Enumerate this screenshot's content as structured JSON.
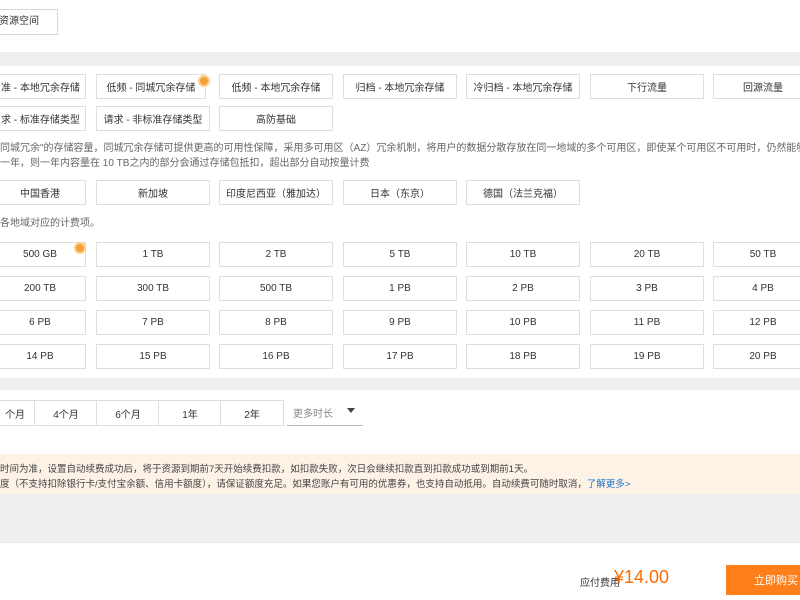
{
  "top": {
    "tag_label": "资源空间"
  },
  "storage_types": [
    {
      "label": "准 - 本地冗余存储"
    },
    {
      "label": "低频 - 同城冗余存储"
    },
    {
      "label": "低频 - 本地冗余存储"
    },
    {
      "label": "归档 - 本地冗余存储"
    },
    {
      "label": "冷归档 - 本地冗余存储"
    },
    {
      "label": "下行流量"
    },
    {
      "label": "回源流量"
    },
    {
      "label": "求 - 标准存储类型"
    },
    {
      "label": "请求 - 非标准存储类型"
    },
    {
      "label": "高防基础"
    }
  ],
  "storage_desc": {
    "line1": "同城冗余\"的存储容量，同城冗余存储可提供更高的可用性保障，采用多可用区（AZ）冗余机制，将用户的数据分散存放在同一地域的多个可用区，即使某个可用区不可用时，仍然能够保障数据的正常",
    "line2": "一年，则一年内容量在 10 TB之内的部分会通过存储包抵扣，超出部分自动按量计费"
  },
  "regions": [
    {
      "label": "中国香港"
    },
    {
      "label": "新加坡"
    },
    {
      "label": "印度尼西亚（雅加达）"
    },
    {
      "label": "日本（东京）"
    },
    {
      "label": "德国（法兰克福）"
    }
  ],
  "region_desc": "各地域对应的计费项。",
  "capacities": [
    "500 GB",
    "1 TB",
    "2 TB",
    "5 TB",
    "10 TB",
    "20 TB",
    "50 TB",
    "200 TB",
    "300 TB",
    "500 TB",
    "1 PB",
    "2 PB",
    "3 PB",
    "4 PB",
    "6 PB",
    "7 PB",
    "8 PB",
    "9 PB",
    "10 PB",
    "11 PB",
    "12 PB",
    "14 PB",
    "15 PB",
    "16 PB",
    "17 PB",
    "18 PB",
    "19 PB",
    "20 PB"
  ],
  "durations": [
    "个月",
    "4个月",
    "6个月",
    "1年",
    "2年"
  ],
  "duration_more": "更多时长",
  "notice": {
    "line1": "时间为准，设置自动续费成功后，将于资源到期前7天开始续费扣款，如扣款失败，次日会继续扣款直到扣款成功或到期前1天。",
    "line2": "度（不支持扣除银行卡/支付宝余额、信用卡额度），请保证额度充足。如果您账户有可用的优惠券，也支持自动抵用。自动续费可随时取消，",
    "link": "了解更多>"
  },
  "footer": {
    "fee_label": "应付费用",
    "fee_amount": "¥14.00",
    "buy_label": "立即购买"
  },
  "colors": {
    "accent": "#ff7f1a",
    "badge": "#f3a13c",
    "notice_bg": "#fdf2e6",
    "link": "#1a73c8"
  }
}
